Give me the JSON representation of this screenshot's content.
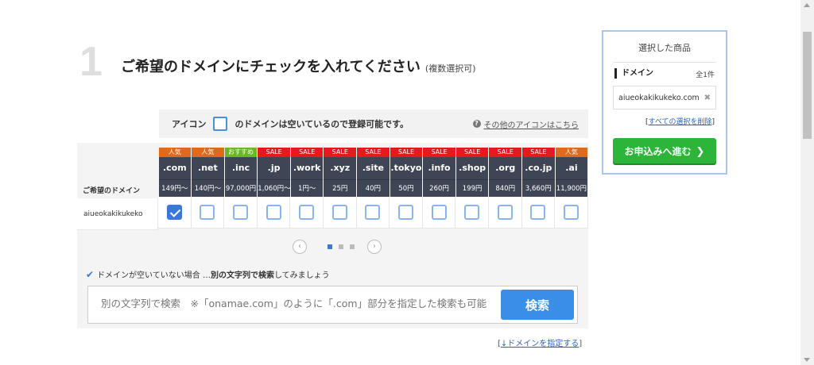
{
  "step": {
    "number": "1",
    "title": "ご希望のドメインにチェックを入れてください",
    "note": "(複数選択可)"
  },
  "legend": {
    "prefix": "アイコン",
    "suffix": "のドメインは空いているので登録可能です。",
    "help_icon": "?",
    "help_link": "その他のアイコンはこちら"
  },
  "table": {
    "row_header": "ご希望のドメイン",
    "domain_name": "aiueokakikukeko",
    "columns": [
      {
        "badge": "人気",
        "badge_type": "popular",
        "tld": ".com",
        "price": "149円～",
        "checked": true
      },
      {
        "badge": "人気",
        "badge_type": "popular",
        "tld": ".net",
        "price": "140円～",
        "checked": false
      },
      {
        "badge": "おすすめ",
        "badge_type": "recommend",
        "tld": ".inc",
        "price": "97,000円",
        "checked": false
      },
      {
        "badge": "SALE",
        "badge_type": "sale",
        "tld": ".jp",
        "price": "1,060円～",
        "checked": false
      },
      {
        "badge": "SALE",
        "badge_type": "sale",
        "tld": ".work",
        "price": "1円～",
        "checked": false
      },
      {
        "badge": "SALE",
        "badge_type": "sale",
        "tld": ".xyz",
        "price": "25円",
        "checked": false
      },
      {
        "badge": "SALE",
        "badge_type": "sale",
        "tld": ".site",
        "price": "40円",
        "checked": false
      },
      {
        "badge": "SALE",
        "badge_type": "sale",
        "tld": ".tokyo",
        "price": "50円",
        "checked": false
      },
      {
        "badge": "SALE",
        "badge_type": "sale",
        "tld": ".info",
        "price": "260円",
        "checked": false
      },
      {
        "badge": "SALE",
        "badge_type": "sale",
        "tld": ".shop",
        "price": "199円",
        "checked": false
      },
      {
        "badge": "SALE",
        "badge_type": "sale",
        "tld": ".org",
        "price": "840円",
        "checked": false
      },
      {
        "badge": "SALE",
        "badge_type": "sale",
        "tld": ".co.jp",
        "price": "3,660円",
        "checked": false
      },
      {
        "badge": "人気",
        "badge_type": "popular",
        "tld": ".ai",
        "price": "11,900円",
        "checked": false
      }
    ]
  },
  "pager": {
    "prev_icon": "‹",
    "next_icon": "›",
    "active_page": 1,
    "pages": 3
  },
  "tip": {
    "check": "✔",
    "prefix": "ドメインが空いていない場合 … ",
    "bold": "別の文字列で検索",
    "suffix": "してみましょう"
  },
  "search": {
    "placeholder": "別の文字列で検索　※「onamae.com」のように「.com」部分を指定した検索も可能",
    "button": "検索"
  },
  "specify": {
    "open": "[",
    "link": "↓ドメインを指定する",
    "close": "]"
  },
  "cart": {
    "title": "選択した商品",
    "label": "ドメイン",
    "count": "全1件",
    "item": "aiueokakikukeko.com",
    "remove_icon": "✖",
    "clear_open": "[",
    "clear_link": "すべての選択を削除",
    "clear_close": "]",
    "proceed": "お申込みへ進む",
    "proceed_arrow": "❯"
  },
  "colors": {
    "popular": "#e06a1b",
    "recommend": "#6cb820",
    "sale": "#e5191e",
    "header": "#3e4655",
    "accent": "#3a8ee6",
    "proceed": "#2db53a"
  }
}
